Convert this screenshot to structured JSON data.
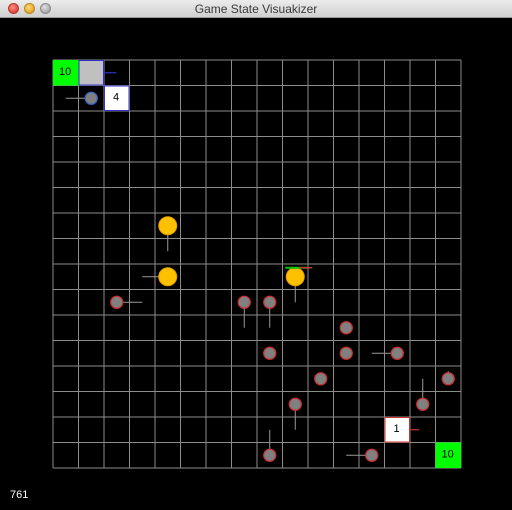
{
  "window": {
    "title": "Game State Visuakizer",
    "frame_counter": "761"
  },
  "board": {
    "cols": 16,
    "rows": 16,
    "grid_color": "#8c8c8c",
    "background": "#000000",
    "colors": {
      "base": "#00ff00",
      "tower_white": "#ffffff",
      "tower_gray": "#c0c0c0",
      "enemy_fill": "#808080",
      "enemy_outline_red": "#c83232",
      "enemy_outline_blue": "#3c64c8",
      "coin_fill": "#ffc000",
      "coin_outline": "#e0a000",
      "link_blue": "#3232c8",
      "link_red": "#c83232",
      "link_green": "#00c800"
    },
    "squares": [
      {
        "col": 0,
        "row": 0,
        "type": "base",
        "label": "10"
      },
      {
        "col": 1,
        "row": 0,
        "type": "tower",
        "fill": "gray",
        "border": "blue",
        "label": "",
        "tail": {
          "dcol": 0.8,
          "drow": 0
        }
      },
      {
        "col": 2,
        "row": 1,
        "type": "tower",
        "fill": "white",
        "border": "blue",
        "label": "4"
      },
      {
        "col": 13,
        "row": 14,
        "type": "tower",
        "fill": "white",
        "border": "red",
        "label": "1",
        "tail": {
          "dcol": 0.6,
          "drow": 0
        }
      },
      {
        "col": 15,
        "row": 15,
        "type": "base",
        "label": "10"
      }
    ],
    "units": [
      {
        "col": 1.5,
        "row": 1.5,
        "kind": "enemy",
        "outline": "blue",
        "tail": {
          "dcol": -1,
          "drow": 0
        }
      },
      {
        "col": 4.5,
        "row": 6.5,
        "kind": "coin",
        "tail": {
          "dcol": 0,
          "drow": 1
        }
      },
      {
        "col": 4.5,
        "row": 8.5,
        "kind": "coin",
        "tail": {
          "dcol": -1,
          "drow": 0
        }
      },
      {
        "col": 9.5,
        "row": 8.5,
        "kind": "coin",
        "tail": {
          "dcol": 0,
          "drow": 1
        },
        "arrow": {
          "dcol": 1,
          "drow": -0.35
        }
      },
      {
        "col": 2.5,
        "row": 9.5,
        "kind": "enemy",
        "outline": "red",
        "tail": {
          "dcol": 1,
          "drow": 0
        }
      },
      {
        "col": 7.5,
        "row": 9.5,
        "kind": "enemy",
        "outline": "red",
        "tail": {
          "dcol": 0,
          "drow": 1
        }
      },
      {
        "col": 8.5,
        "row": 9.5,
        "kind": "enemy",
        "outline": "red",
        "tail": {
          "dcol": 0,
          "drow": 1
        }
      },
      {
        "col": 11.5,
        "row": 10.5,
        "kind": "enemy",
        "outline": "red"
      },
      {
        "col": 8.5,
        "row": 11.5,
        "kind": "enemy",
        "outline": "red"
      },
      {
        "col": 11.5,
        "row": 11.5,
        "kind": "enemy",
        "outline": "red"
      },
      {
        "col": 13.5,
        "row": 11.5,
        "kind": "enemy",
        "outline": "red",
        "tail": {
          "dcol": -1,
          "drow": 0
        }
      },
      {
        "col": 10.5,
        "row": 12.5,
        "kind": "enemy",
        "outline": "red"
      },
      {
        "col": 15.5,
        "row": 12.5,
        "kind": "enemy",
        "outline": "red",
        "tail": {
          "dcol": 0,
          "drow": -0.3
        }
      },
      {
        "col": 14.5,
        "row": 13.5,
        "kind": "enemy",
        "outline": "red",
        "tail": {
          "dcol": 0,
          "drow": -1
        }
      },
      {
        "col": 9.5,
        "row": 13.5,
        "kind": "enemy",
        "outline": "red",
        "tail": {
          "dcol": 0,
          "drow": 1
        }
      },
      {
        "col": 8.5,
        "row": 15.5,
        "kind": "enemy",
        "outline": "red",
        "tail": {
          "dcol": 0,
          "drow": -1
        }
      },
      {
        "col": 12.5,
        "row": 15.5,
        "kind": "enemy",
        "outline": "red",
        "tail": {
          "dcol": -1,
          "drow": 0
        }
      }
    ]
  }
}
